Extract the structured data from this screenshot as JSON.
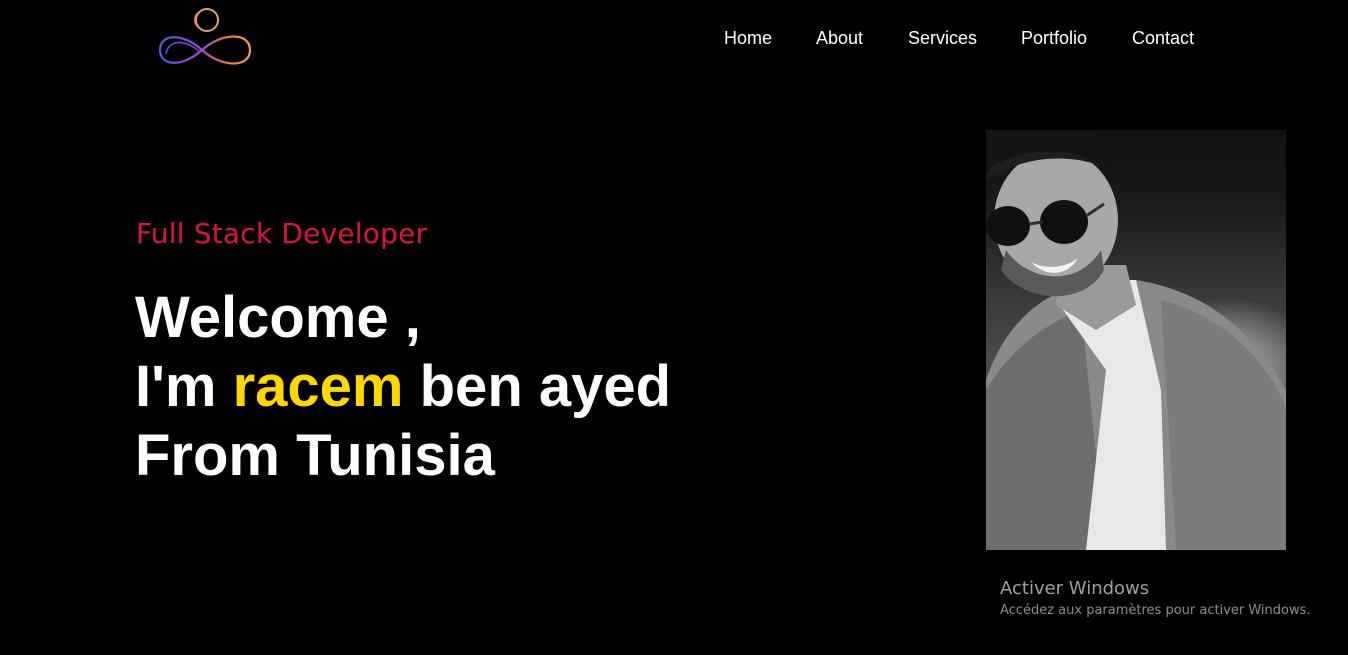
{
  "nav": {
    "items": [
      {
        "label": "Home"
      },
      {
        "label": "About"
      },
      {
        "label": "Services"
      },
      {
        "label": "Portfolio"
      },
      {
        "label": "Contact"
      }
    ]
  },
  "hero": {
    "subtitle": "Full Stack Developer",
    "line1": "Welcome ,",
    "line2_prefix": "I'm ",
    "name": "racem",
    "line2_suffix": " ben ayed",
    "line3": "From Tunisia"
  },
  "overlay": {
    "title": "Activer Windows",
    "message": "Accédez aux paramètres pour activer Windows."
  },
  "colors": {
    "background": "#000000",
    "accent_subtitle": "#dc143c",
    "accent_name": "#ffd700",
    "text": "#ffffff"
  },
  "icons": {
    "logo": "infinity-logo-icon"
  }
}
